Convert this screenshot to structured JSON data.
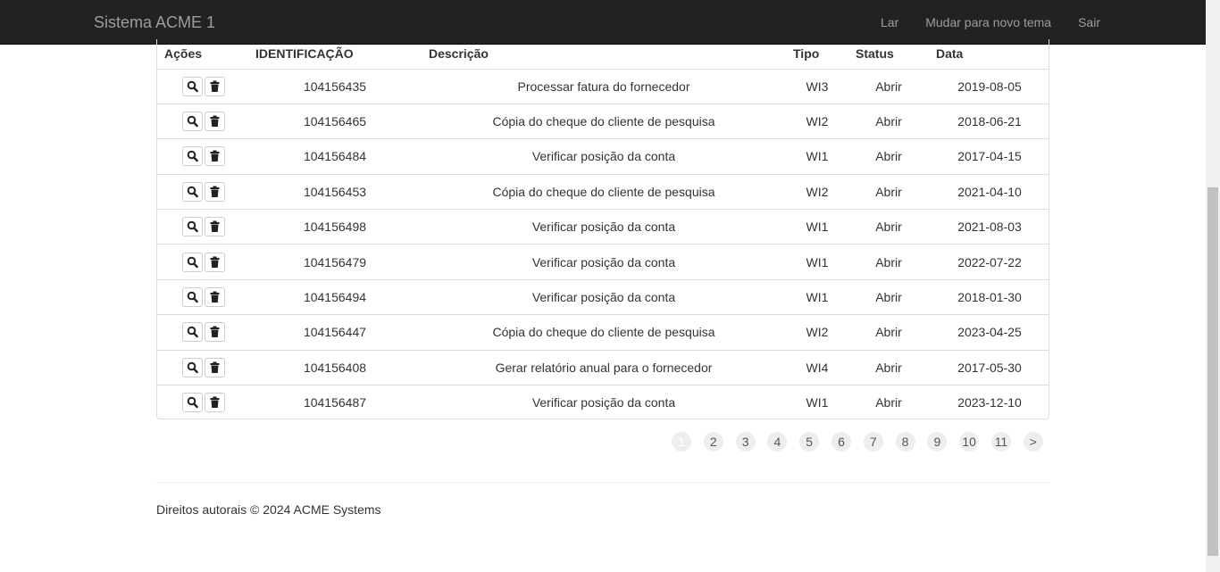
{
  "navbar": {
    "brand": "Sistema ACME 1",
    "links": [
      "Lar",
      "Mudar para novo tema",
      "Sair"
    ]
  },
  "table": {
    "headers": [
      "Ações",
      "IDENTIFICAÇÃO",
      "Descrição",
      "Tipo",
      "Status",
      "Data"
    ],
    "action_icons": [
      "search-icon",
      "trash-icon"
    ],
    "rows": [
      {
        "id": "104156435",
        "descricao": "Processar fatura do fornecedor",
        "tipo": "WI3",
        "status": "Abrir",
        "data": "2019-08-05"
      },
      {
        "id": "104156465",
        "descricao": "Cópia do cheque do cliente de pesquisa",
        "tipo": "WI2",
        "status": "Abrir",
        "data": "2018-06-21"
      },
      {
        "id": "104156484",
        "descricao": "Verificar posição da conta",
        "tipo": "WI1",
        "status": "Abrir",
        "data": "2017-04-15"
      },
      {
        "id": "104156453",
        "descricao": "Cópia do cheque do cliente de pesquisa",
        "tipo": "WI2",
        "status": "Abrir",
        "data": "2021-04-10"
      },
      {
        "id": "104156498",
        "descricao": "Verificar posição da conta",
        "tipo": "WI1",
        "status": "Abrir",
        "data": "2021-08-03"
      },
      {
        "id": "104156479",
        "descricao": "Verificar posição da conta",
        "tipo": "WI1",
        "status": "Abrir",
        "data": "2022-07-22"
      },
      {
        "id": "104156494",
        "descricao": "Verificar posição da conta",
        "tipo": "WI1",
        "status": "Abrir",
        "data": "2018-01-30"
      },
      {
        "id": "104156447",
        "descricao": "Cópia do cheque do cliente de pesquisa",
        "tipo": "WI2",
        "status": "Abrir",
        "data": "2023-04-25"
      },
      {
        "id": "104156408",
        "descricao": "Gerar relatório anual para o fornecedor",
        "tipo": "WI4",
        "status": "Abrir",
        "data": "2017-05-30"
      },
      {
        "id": "104156487",
        "descricao": "Verificar posição da conta",
        "tipo": "WI1",
        "status": "Abrir",
        "data": "2023-12-10"
      }
    ]
  },
  "pagination": {
    "pages": [
      "1",
      "2",
      "3",
      "4",
      "5",
      "6",
      "7",
      "8",
      "9",
      "10",
      "11",
      ">"
    ],
    "current": "1"
  },
  "footer": {
    "copyright": "Direitos autorais © 2024 ACME Systems"
  },
  "colors": {
    "navbar_bg": "#222222",
    "navbar_text": "#9d9d9d",
    "border": "#dddddd",
    "text": "#333333"
  }
}
